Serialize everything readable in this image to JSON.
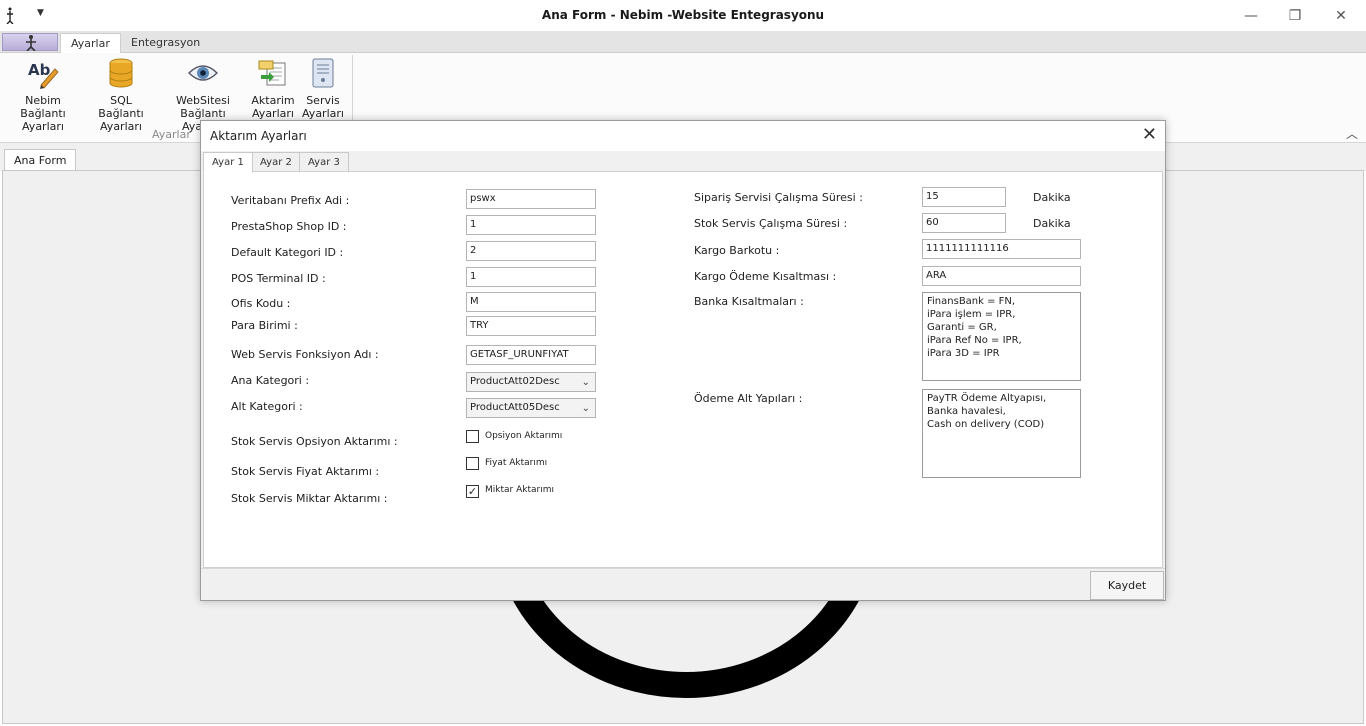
{
  "window": {
    "title": "Ana Form - Nebim -Website Entegrasyonu"
  },
  "ribbon": {
    "tabs": [
      {
        "label": "Ayarlar"
      },
      {
        "label": "Entegrasyon"
      }
    ],
    "buttons": [
      {
        "line1": "Nebim Bağlantı",
        "line2": "Ayarları",
        "icon": "ab-pencil-icon"
      },
      {
        "line1": "SQL Bağlantı",
        "line2": "Ayarları",
        "icon": "database-icon"
      },
      {
        "line1": "WebSitesi",
        "line2": "Bağlantı Ayarları",
        "icon": "eye-icon"
      },
      {
        "line1": "Aktarim",
        "line2": "Ayarları",
        "icon": "transfer-icon"
      },
      {
        "line1": "Servis",
        "line2": "Ayarları",
        "icon": "service-icon"
      }
    ],
    "group_label": "Ayarlar"
  },
  "document_tab": {
    "label": "Ana Form"
  },
  "dialog": {
    "title": "Aktarım Ayarları",
    "tabs": [
      {
        "label": "Ayar 1"
      },
      {
        "label": "Ayar 2"
      },
      {
        "label": "Ayar 3"
      }
    ],
    "left": {
      "prefix": {
        "label": "Veritabanı Prefix Adi :",
        "value": "pswx"
      },
      "shop_id": {
        "label": "PrestaShop Shop ID :",
        "value": "1"
      },
      "category_id": {
        "label": "Default Kategori ID :",
        "value": "2"
      },
      "pos_id": {
        "label": "POS Terminal ID :",
        "value": "1"
      },
      "office": {
        "label": "Ofis Kodu :",
        "value": "M"
      },
      "currency": {
        "label": "Para Birimi  :",
        "value": "TRY"
      },
      "ws_function": {
        "label": "Web Servis Fonksiyon Adı :",
        "value": "GETASF_URUNFIYAT"
      },
      "main_category": {
        "label": "Ana Kategori  :",
        "value": "ProductAtt02Desc"
      },
      "sub_category": {
        "label": "Alt Kategori :",
        "value": "ProductAtt05Desc"
      },
      "option_transfer": {
        "label": "Stok Servis Opsiyon Aktarımı :",
        "check_label": "Opsiyon Aktarımı",
        "checked": false
      },
      "price_transfer": {
        "label": "Stok Servis Fiyat Aktarımı :",
        "check_label": "Fiyat Aktarımı",
        "checked": false
      },
      "qty_transfer": {
        "label": "Stok Servis Miktar Aktarımı :",
        "check_label": "Miktar Aktarımı",
        "checked": true
      }
    },
    "right": {
      "order_interval": {
        "label": "Sipariş Servisi Çalışma Süresi :",
        "value": "15",
        "unit": "Dakika"
      },
      "stock_interval": {
        "label": "Stok Servis Çalışma Süresi :",
        "value": "60",
        "unit": "Dakika"
      },
      "cargo_barcode": {
        "label": "Kargo Barkotu  :",
        "value": "1111111111116"
      },
      "cargo_payment": {
        "label": "Kargo Ödeme Kısaltması :",
        "value": "ARA"
      },
      "bank_abbrev": {
        "label": "Banka Kısaltmaları  :",
        "lines": [
          "FinansBank = FN,",
          "iPara işlem = IPR,",
          "Garanti = GR,",
          "iPara Ref No = IPR,",
          "iPara 3D = IPR"
        ]
      },
      "payment_infra": {
        "label": "Ödeme Alt Yapıları :",
        "lines": [
          "PayTR Ödeme Altyapısı,",
          "Banka havalesi,",
          "Cash on delivery (COD)"
        ]
      }
    },
    "save_label": "Kaydet"
  }
}
